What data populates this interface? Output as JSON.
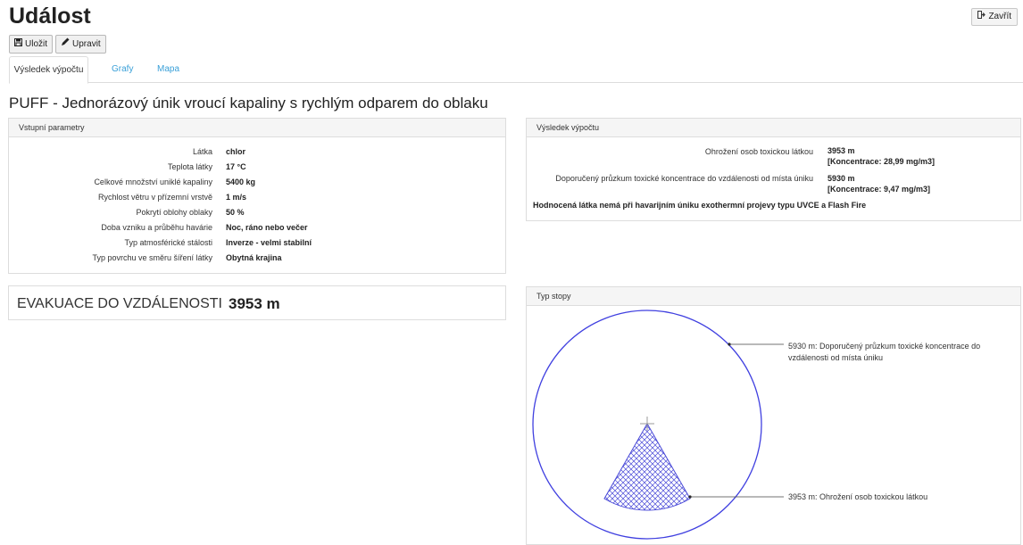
{
  "header": {
    "title": "Událost",
    "close_label": "Zavřít"
  },
  "toolbar": {
    "save_label": "Uložit",
    "edit_label": "Upravit"
  },
  "tabs": [
    {
      "label": "Výsledek výpočtu",
      "active": true
    },
    {
      "label": "Grafy",
      "active": false
    },
    {
      "label": "Mapa",
      "active": false
    }
  ],
  "scenario_title": "PUFF - Jednorázový únik vroucí kapaliny s rychlým odparem do oblaku",
  "input_panel": {
    "title": "Vstupní parametry",
    "rows": [
      {
        "label": "Látka",
        "value": "chlor"
      },
      {
        "label": "Teplota látky",
        "value": "17 °C"
      },
      {
        "label": "Celkové množství uniklé kapaliny",
        "value": "5400 kg"
      },
      {
        "label": "Rychlost větru v přízemní vrstvě",
        "value": "1 m/s"
      },
      {
        "label": "Pokrytí oblohy oblaky",
        "value": "50 %"
      },
      {
        "label": "Doba vzniku a průběhu havárie",
        "value": "Noc, ráno nebo večer"
      },
      {
        "label": "Typ atmosférické stálosti",
        "value": "Inverze - velmi stabilní"
      },
      {
        "label": "Typ povrchu ve směru šíření látky",
        "value": "Obytná krajina"
      }
    ]
  },
  "result_panel": {
    "title": "Výsledek výpočtu",
    "rows": [
      {
        "label": "Ohrožení osob toxickou látkou",
        "value": "3953 m",
        "detail": "[Koncentrace: 28,99 mg/m3]"
      },
      {
        "label": "Doporučený průzkum toxické koncentrace do vzdálenosti od místa úniku",
        "value": "5930 m",
        "detail": "[Koncentrace: 9,47 mg/m3]"
      }
    ],
    "note": "Hodnocená látka nemá při havarijním úniku exothermní projevy typu UVCE a Flash Fire"
  },
  "evacuation": {
    "label": "EVAKUACE DO VZDÁLENOSTI",
    "value": "3953 m"
  },
  "trace_panel": {
    "title": "Typ stopy",
    "outer_label": "5930 m: Doporučený průzkum toxické koncentrace do vzdálenosti od místa úniku",
    "inner_label": "3953 m: Ohrožení osob toxickou látkou"
  },
  "colors": {
    "accent": "#3aa0d8",
    "circle": "#4040e0",
    "hatch": "#4a4ad8"
  }
}
